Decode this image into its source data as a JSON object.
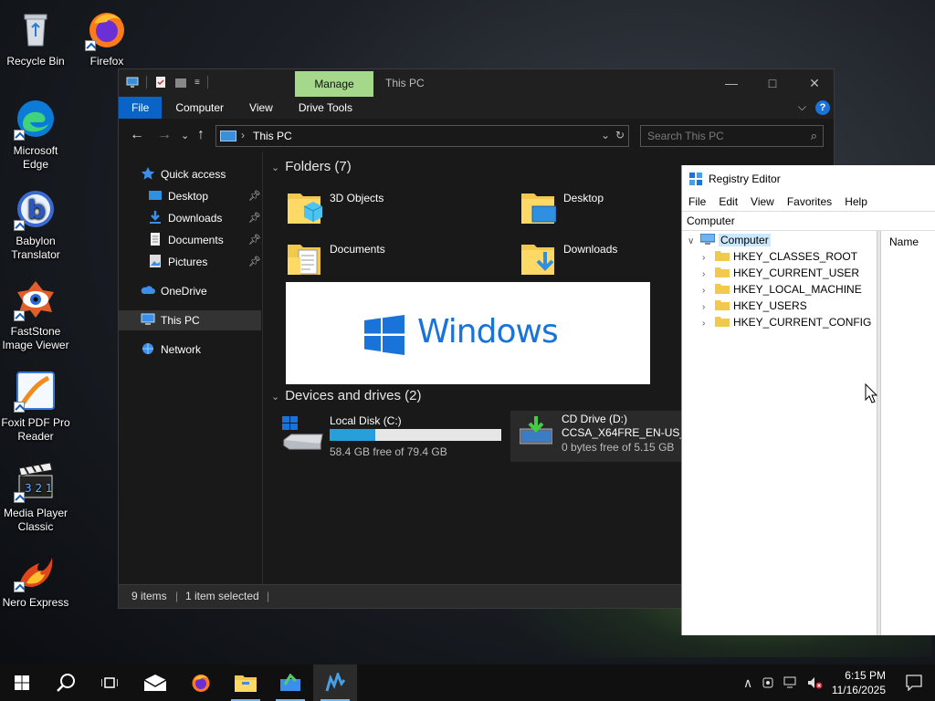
{
  "desktop": {
    "icons": [
      {
        "label": "Recycle Bin"
      },
      {
        "label": "Firefox"
      },
      {
        "label": "Microsoft Edge"
      },
      {
        "label": "Babylon Translator"
      },
      {
        "label": "FastStone Image Viewer"
      },
      {
        "label": "Foxit PDF Pro Reader"
      },
      {
        "label": "Media Player Classic"
      },
      {
        "label": "Nero Express"
      }
    ]
  },
  "explorer": {
    "title": "This PC",
    "manage_tab": "Manage",
    "tabs": [
      "File",
      "Computer",
      "View",
      "Drive Tools"
    ],
    "address": "This PC",
    "search_placeholder": "Search This PC",
    "nav": {
      "quick_access": "Quick access",
      "items": [
        "Desktop",
        "Downloads",
        "Documents",
        "Pictures"
      ],
      "onedrive": "OneDrive",
      "this_pc": "This PC",
      "network": "Network"
    },
    "folders_header": "Folders (7)",
    "folders": [
      "3D Objects",
      "Desktop",
      "Documents",
      "Downloads"
    ],
    "banner_text": "Windows",
    "devices_header": "Devices and drives (2)",
    "drives": [
      {
        "name": "Local Disk (C:)",
        "free": "58.4 GB free of 79.4 GB",
        "used_fraction": 0.265
      },
      {
        "name": "CD Drive (D:)",
        "label": "CCSA_X64FRE_EN-US_DV",
        "free": "0 bytes free of 5.15 GB"
      }
    ],
    "status": {
      "items": "9 items",
      "selected": "1 item selected"
    }
  },
  "regedit": {
    "title": "Registry Editor",
    "menu": [
      "File",
      "Edit",
      "View",
      "Favorites",
      "Help"
    ],
    "address": "Computer",
    "tree_root": "Computer",
    "keys": [
      "HKEY_CLASSES_ROOT",
      "HKEY_CURRENT_USER",
      "HKEY_LOCAL_MACHINE",
      "HKEY_USERS",
      "HKEY_CURRENT_CONFIG"
    ],
    "column_name": "Name"
  },
  "taskbar": {
    "time": "6:15 PM",
    "date": "11/16/2025"
  },
  "colors": {
    "accent": "#0a64c8",
    "manage_tab": "#a6d88c",
    "drive_bar": "#26a0da",
    "folder": "#f2c94c"
  }
}
